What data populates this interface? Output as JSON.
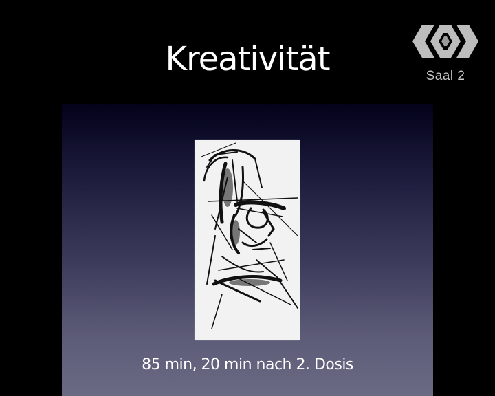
{
  "slide": {
    "title": "Kreativität",
    "caption": "85 min, 20 min nach 2. Dosis",
    "artwork_icon": "portrait-sketch-image"
  },
  "overlay": {
    "logo_icon": "broadcast-logo-icon",
    "room_label": "Saal 2"
  },
  "colors": {
    "background": "#000000",
    "slide_gradient_top": "#03021a",
    "slide_gradient_bottom": "#6a6a84",
    "text": "#ffffff",
    "logo": "#bdbdbd"
  }
}
